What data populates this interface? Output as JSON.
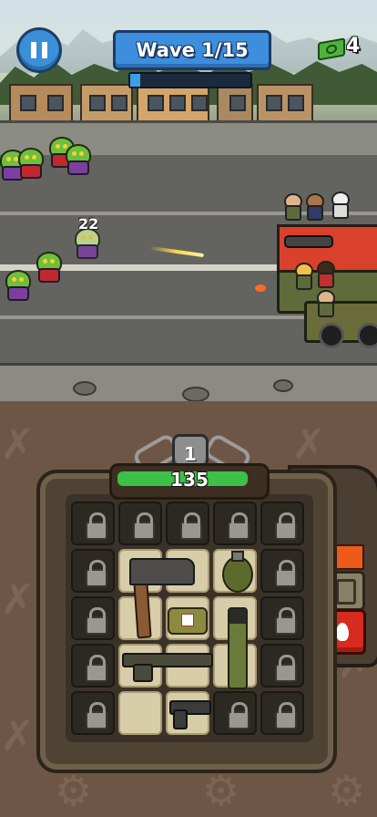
{
  "hud": {
    "wave_label": "Wave 1/15",
    "wave_progress": 0.08,
    "cash_count": "4",
    "pause_icon": "pause-icon",
    "cash_icon": "cash-icon"
  },
  "battle": {
    "damage_popup": "22"
  },
  "player": {
    "level": "1",
    "health": "135",
    "health_fraction": 0.93
  },
  "inventory": {
    "grid_size": "5x5",
    "items": [
      "axe",
      "grenade",
      "medkit",
      "assault-rifle",
      "rocket-launcher",
      "pistol"
    ]
  },
  "side_panel": {
    "fuel_icon": "fuel-can-icon",
    "fire_icon": "fire-icon",
    "accent_color": "#ef5a1a"
  }
}
